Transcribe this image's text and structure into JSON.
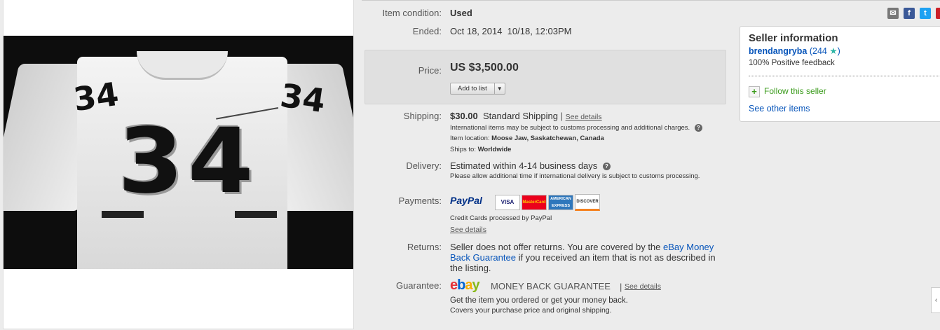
{
  "details": {
    "condition_label": "Item condition:",
    "condition_value": "Used",
    "ended_label": "Ended:",
    "ended_value": "Oct 18, 2014  10/18, 12:03PM",
    "price_label": "Price:",
    "price_value": "US $3,500.00",
    "add_to_list": "Add to list",
    "shipping_label": "Shipping:",
    "shipping_cost": "$30.00",
    "shipping_method": "Standard Shipping",
    "shipping_see_details": "See details",
    "shipping_intl_note": "International items may be subject to customs processing and additional charges.",
    "item_location_label": "Item location:",
    "item_location_value": "Moose Jaw, Saskatchewan, Canada",
    "ships_to_label": "Ships to:",
    "ships_to_value": "Worldwide",
    "delivery_label": "Delivery:",
    "delivery_value": "Estimated within 4-14 business days",
    "delivery_note": "Please allow additional time if international delivery is subject to customs processing.",
    "payments_label": "Payments:",
    "paypal": "PayPal",
    "cards": [
      "VISA",
      "MasterCard",
      "AMERICAN EXPRESS",
      "DISCOVER"
    ],
    "cards_note": "Credit Cards processed by PayPal",
    "payments_see_details": "See details",
    "returns_label": "Returns:",
    "returns_text_1": "Seller does not offer returns. You are covered by the ",
    "returns_link": "eBay Money Back Guarantee",
    "returns_text_2": " if you received an item that is not as described in the listing.",
    "guarantee_label": "Guarantee:",
    "guarantee_title": "MONEY BACK GUARANTEE",
    "guarantee_see_details": "See details",
    "guarantee_line1": "Get the item you ordered or get your money back.",
    "guarantee_line2": "Covers your purchase price and original shipping."
  },
  "seller": {
    "title": "Seller information",
    "username": "brendangryba",
    "feedback_score": "(244",
    "feedback_close": ")",
    "positive": "100% Positive feedback",
    "follow": "Follow this seller",
    "see_other": "See other items"
  },
  "photo": {
    "number": "34"
  },
  "colors": {
    "link_blue": "#0654ba",
    "follow_green": "#3a9b1b",
    "star_teal": "#2bb5a5"
  },
  "icons": [
    "email-icon",
    "facebook-icon",
    "twitter-icon",
    "pinterest-icon",
    "help-icon",
    "star-icon",
    "follow-plus-icon"
  ]
}
